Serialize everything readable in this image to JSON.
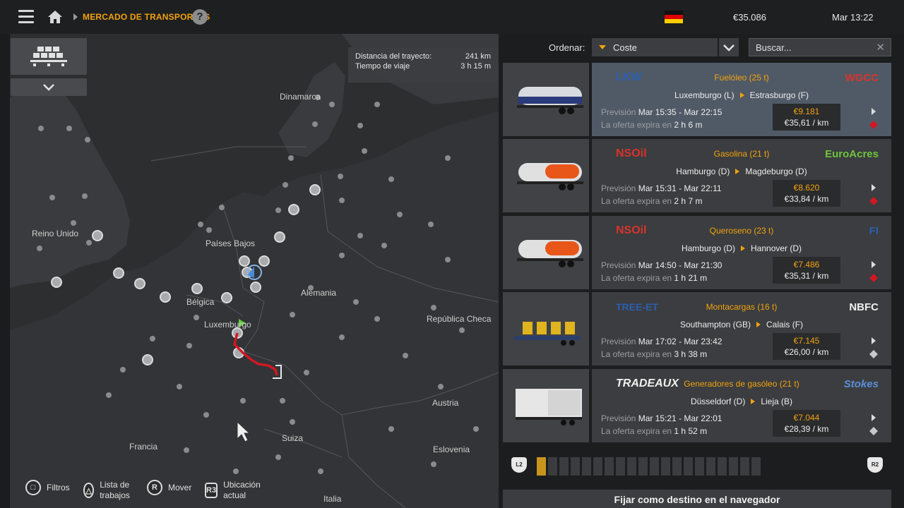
{
  "header": {
    "breadcrumb": "MERCADO DE TRANSPORTES",
    "help": "?",
    "money": "€35.086",
    "clock": "Mar 13:22"
  },
  "colors": {
    "accent": "#f2a20e",
    "route": "#d01823",
    "selected": "#505a66"
  },
  "map": {
    "trip": {
      "distance_label": "Distancia del trayecto:",
      "distance_value": "241 km",
      "time_label": "Tiempo de viaje",
      "time_value": "3 h 15 m"
    },
    "labels": [
      "Dinamarca",
      "Reino Unido",
      "Países Bajos",
      "Alemania",
      "Bélgica",
      "Luxemburgo",
      "República Checa",
      "Austria",
      "Francia",
      "Suiza",
      "Eslovenia",
      "Italia"
    ],
    "legend": [
      {
        "icon": "square-button-icon",
        "label": "Filtros"
      },
      {
        "icon": "triangle-button-icon",
        "label": "Lista de trabajos"
      },
      {
        "icon": "r-stick-icon",
        "label": "Mover"
      },
      {
        "icon": "r3-button-icon",
        "label": "Ubicación actual"
      }
    ]
  },
  "sort": {
    "label": "Ordenar:",
    "value": "Coste",
    "search_placeholder": "Buscar..."
  },
  "jobs": [
    {
      "company": "LKW",
      "destination_company": "WGCC",
      "cargo": "Fuelóleo (25 t)",
      "from": "Luxemburgo (L)",
      "to": "Estrasburgo (F)",
      "forecast_label": "Previsión",
      "forecast": "Mar 15:35 - Mar 22:15",
      "expires_label": "La oferta expira en",
      "expires": "2 h 6 m",
      "payment": "€9.181",
      "per_km": "€35,61 / km",
      "selected": true
    },
    {
      "company": "NSOil",
      "destination_company": "EuroAcres",
      "cargo": "Gasolina (21 t)",
      "from": "Hamburgo (D)",
      "to": "Magdeburgo (D)",
      "forecast_label": "Previsión",
      "forecast": "Mar 15:31 - Mar 22:11",
      "expires_label": "La oferta expira en",
      "expires": "2 h 7 m",
      "payment": "€8.620",
      "per_km": "€33,84 / km",
      "selected": false
    },
    {
      "company": "NSOil",
      "destination_company": "FI",
      "cargo": "Queroseno (23 t)",
      "from": "Hamburgo (D)",
      "to": "Hannover (D)",
      "forecast_label": "Previsión",
      "forecast": "Mar 14:50 - Mar 21:30",
      "expires_label": "La oferta expira en",
      "expires": "1 h 21 m",
      "payment": "€7.486",
      "per_km": "€35,31 / km",
      "selected": false
    },
    {
      "company": "TREE-ET",
      "destination_company": "NBFC",
      "cargo": "Montacargas (16 t)",
      "from": "Southampton (GB)",
      "to": "Calais (F)",
      "forecast_label": "Previsión",
      "forecast": "Mar 17:02 - Mar 23:42",
      "expires_label": "La oferta expira en",
      "expires": "3 h 38 m",
      "payment": "€7.145",
      "per_km": "€26,00 / km",
      "selected": false
    },
    {
      "company": "TRADEAUX",
      "destination_company": "Stokes",
      "cargo": "Generadores de gasóleo (21 t)",
      "from": "Düsseldorf (D)",
      "to": "Lieja (B)",
      "forecast_label": "Previsión",
      "forecast": "Mar 15:21 - Mar 22:01",
      "expires_label": "La oferta expira en",
      "expires": "1 h 52 m",
      "payment": "€7.044",
      "per_km": "€28,39 / km",
      "selected": false
    }
  ],
  "pager": {
    "left": "L2",
    "right": "R2",
    "current_page": 1,
    "total_pages": 20
  },
  "nav_button": "Fijar como destino en el navegador"
}
